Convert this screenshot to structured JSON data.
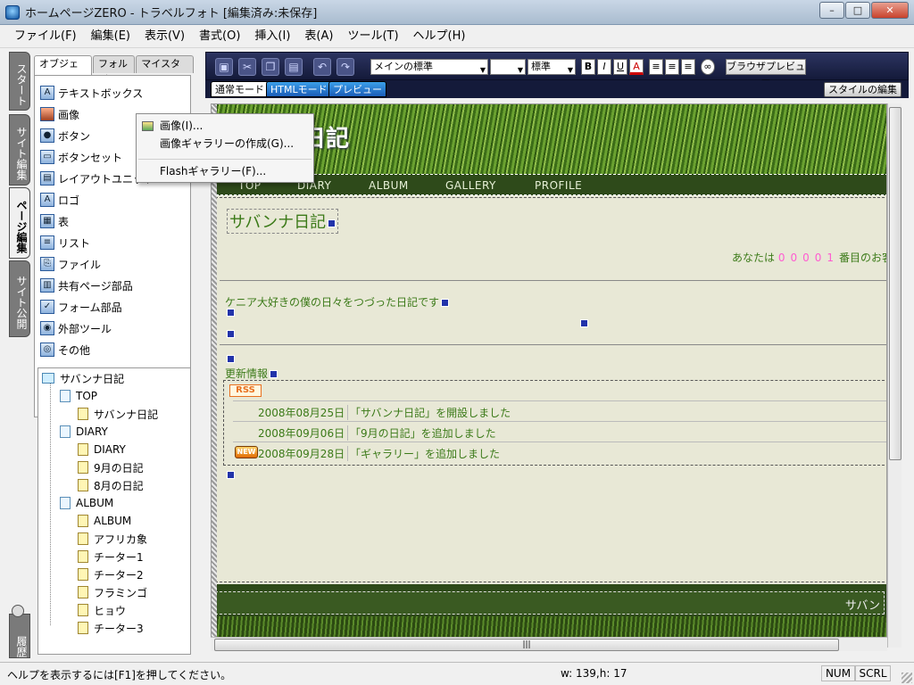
{
  "window": {
    "title": "ホームページZERO - トラベルフォト [編集済み:未保存]",
    "buttons": {
      "minimize": "–",
      "maximize": "□",
      "close": "✕"
    }
  },
  "menubar": [
    "ファイル(F)",
    "編集(E)",
    "表示(V)",
    "書式(O)",
    "挿入(I)",
    "表(A)",
    "ツール(T)",
    "ヘルプ(H)"
  ],
  "vertical_tabs": [
    "スタート",
    "サイト編集",
    "ページ編集",
    "サイト公開"
  ],
  "history_tab": "履歴",
  "panel_tabs": [
    "オブジェクト",
    "フォルダ",
    "マイスタイル"
  ],
  "objects": [
    "テキストボックス",
    "画像",
    "ボタン",
    "ボタンセット",
    "レイアウトユニット",
    "ロゴ",
    "表",
    "リスト",
    "ファイル",
    "共有ページ部品",
    "フォーム部品",
    "外部ツール",
    "その他"
  ],
  "context_menu": [
    "画像(I)...",
    "画像ギャラリーの作成(G)...",
    "Flashギャラリー(F)..."
  ],
  "tree": {
    "site": "サバンナ日記",
    "nodes": [
      {
        "label": "TOP"
      },
      {
        "label": "サバンナ日記"
      },
      {
        "label": "DIARY"
      },
      {
        "label": "DIARY"
      },
      {
        "label": "9月の日記"
      },
      {
        "label": "8月の日記"
      },
      {
        "label": "ALBUM"
      },
      {
        "label": "ALBUM"
      },
      {
        "label": "アフリカ象"
      },
      {
        "label": "チーター1"
      },
      {
        "label": "チーター2"
      },
      {
        "label": "フラミンゴ"
      },
      {
        "label": "ヒョウ"
      },
      {
        "label": "チーター3"
      }
    ]
  },
  "toolbar": {
    "font_select": "メインの標準",
    "size_select": "",
    "style_select": "標準",
    "bold": "B",
    "italic": "I",
    "underline": "U",
    "color": "A",
    "browser_preview": "ブラウザプレビュー"
  },
  "mode_tabs": [
    "通常モード",
    "HTMLモード",
    "プレビュー"
  ],
  "style_edit": "スタイルの編集",
  "page": {
    "banner_title": "日記",
    "nav": [
      "TOP",
      "DIARY",
      "ALBUM",
      "GALLERY",
      "PROFILE"
    ],
    "title": "サバンナ日記",
    "counter_prefix": "あなたは",
    "counter_digits": "00001",
    "counter_suffix": "番目のお客",
    "description": "ケニア大好きの僕の日々をつづった日記です",
    "news_heading": "更新情報",
    "rss": "RSS",
    "news": [
      {
        "date": "2008年08月25日",
        "text": "「サバンナ日記」を開設しました",
        "new": false
      },
      {
        "date": "2008年09月06日",
        "text": "「9月の日記」を追加しました",
        "new": false
      },
      {
        "date": "2008年09月28日",
        "text": "「ギャラリー」を追加しました",
        "new": true
      }
    ],
    "new_badge": "NEW",
    "footer": "サバン"
  },
  "statusbar": {
    "help": "ヘルプを表示するには[F1]を押してください。",
    "size": "w: 139,h:  17",
    "num": "NUM",
    "scrl": "SCRL"
  }
}
